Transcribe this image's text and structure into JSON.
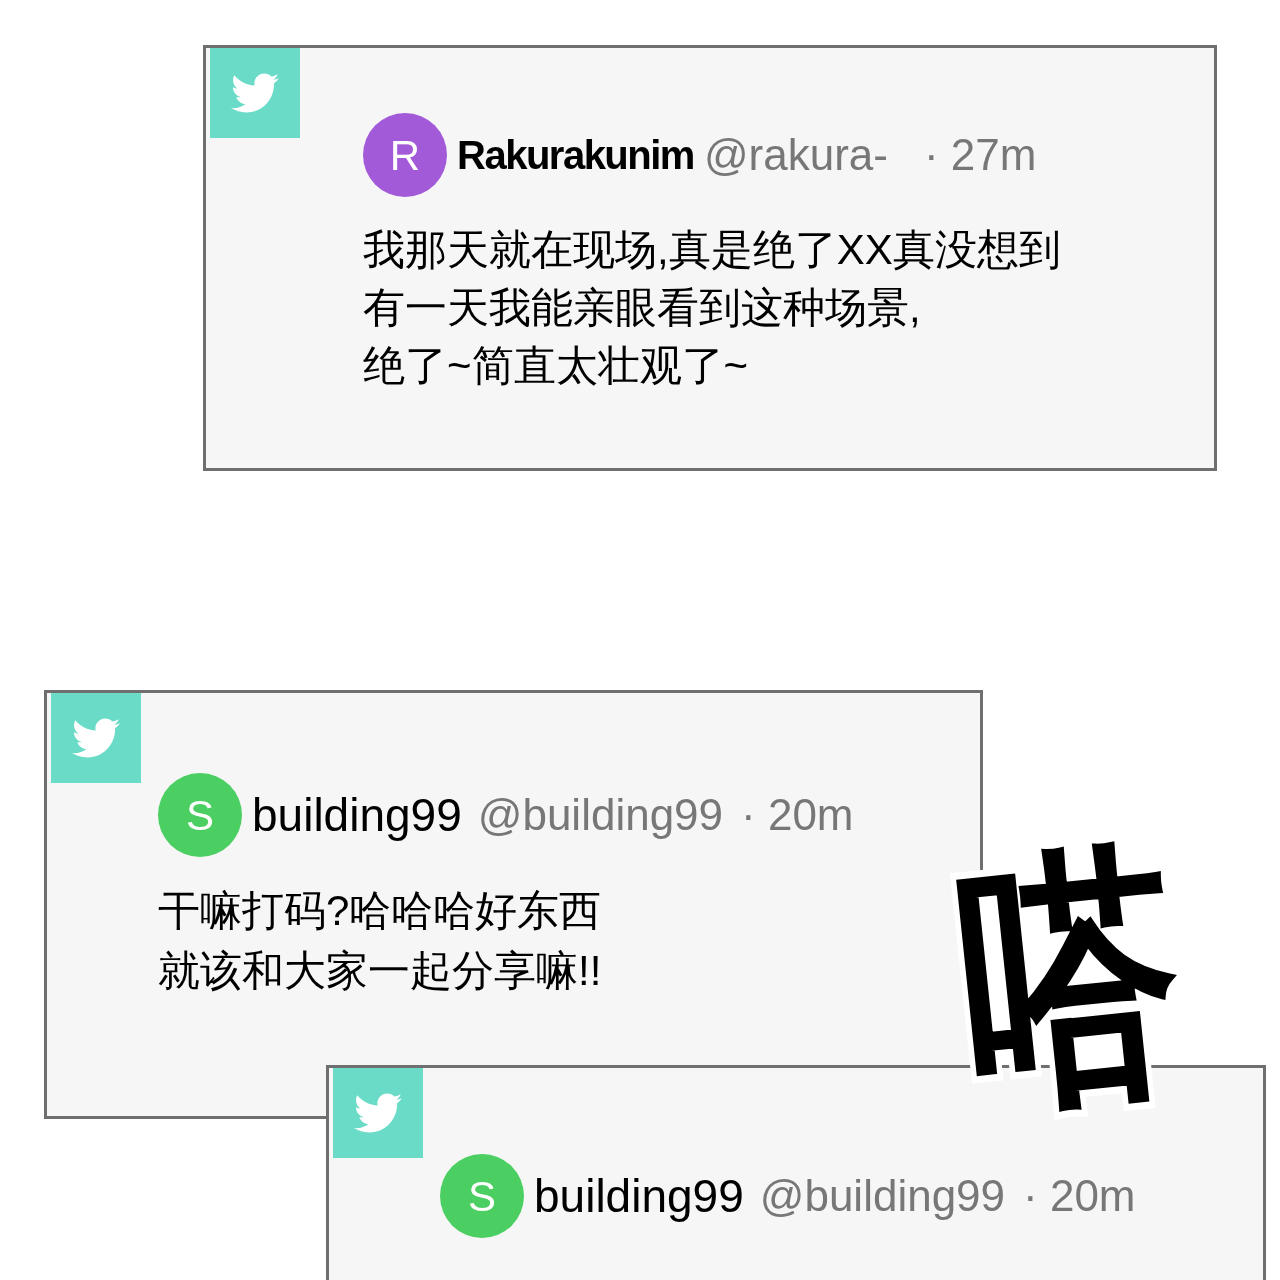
{
  "tweets": [
    {
      "avatar_letter": "R",
      "color": "#a35ad9",
      "name": "Rakurakunim",
      "handle": "@rakura-",
      "time": "· 27m",
      "lines": [
        "我那天就在现场,真是绝了XX真没想到",
        "有一天我能亲眼看到这种场景,",
        "绝了~简直太壮观了~"
      ]
    },
    {
      "avatar_letter": "S",
      "color": "#4ccf62",
      "name": "building99",
      "handle": "@building99",
      "time": "· 20m",
      "lines": [
        "干嘛打码?哈哈哈好东西",
        "就该和大家一起分享嘛!!"
      ]
    },
    {
      "avatar_letter": "S",
      "color": "#4ccf62",
      "name": "building99",
      "handle": "@building99",
      "time": "· 20m"
    }
  ],
  "sound_effect": "嗒"
}
